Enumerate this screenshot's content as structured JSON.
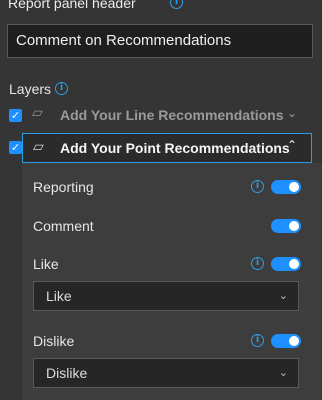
{
  "header": {
    "label": "Report panel header",
    "info_icon": "info-icon",
    "value": "Comment on Recommendations"
  },
  "layers": {
    "label": "Layers",
    "info_icon": "info-icon",
    "items": [
      {
        "name": "Add Your Line Recommendations",
        "checked": true,
        "expanded": false,
        "icon": "polygon-icon"
      },
      {
        "name": "Add Your Point Recommendations",
        "checked": true,
        "expanded": true,
        "icon": "polygon-icon"
      }
    ]
  },
  "options": {
    "reporting": {
      "label": "Reporting",
      "enabled": true
    },
    "comment": {
      "label": "Comment",
      "enabled": true
    },
    "like": {
      "label": "Like",
      "enabled": true,
      "selected": "Like"
    },
    "dislike": {
      "label": "Dislike",
      "enabled": true,
      "selected": "Dislike"
    }
  },
  "colors": {
    "accent": "#1e90ff",
    "background": "#353535"
  }
}
